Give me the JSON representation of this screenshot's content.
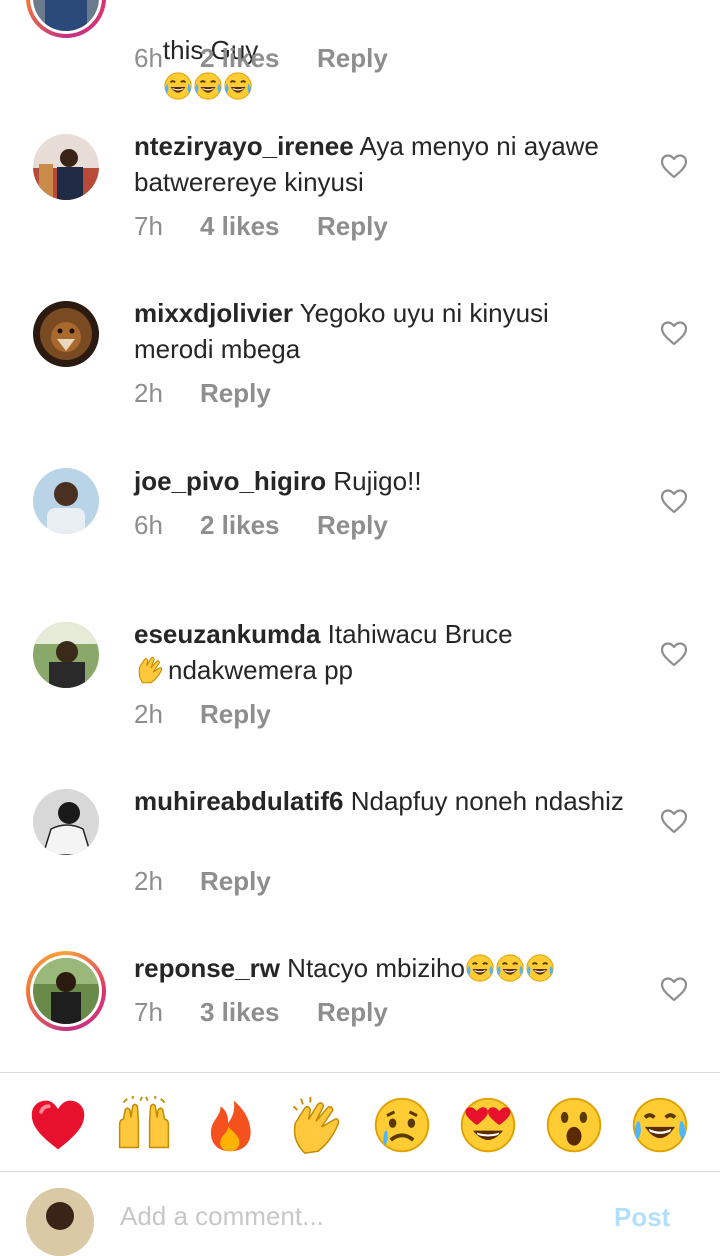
{
  "comments": [
    {
      "username": "",
      "text": "this Guy",
      "emoji_count": 3,
      "time": "6h",
      "likes": "2 likes",
      "reply": "Reply"
    },
    {
      "username": "nteziryayo_irenee",
      "text": " Aya menyo ni ayawe batwerereye kinyusi",
      "time": "7h",
      "likes": "4 likes",
      "reply": "Reply"
    },
    {
      "username": "mixxdjolivier",
      "text": " Yegoko uyu ni kinyusi merodi mbega",
      "time": "2h",
      "likes": "",
      "reply": "Reply"
    },
    {
      "username": "joe_pivo_higiro",
      "text": " Rujigo!!",
      "time": "6h",
      "likes": "2 likes",
      "reply": "Reply"
    },
    {
      "username": "eseuzankumda",
      "text": " Itahiwacu Bruce",
      "text2": "ndakwemera pp",
      "time": "2h",
      "likes": "",
      "reply": "Reply"
    },
    {
      "username": "muhireabdulatif6",
      "text": " Ndapfuy noneh ndashiz",
      "time": "2h",
      "likes": "",
      "reply": "Reply"
    },
    {
      "username": "reponse_rw",
      "text": " Ntacyo mbiziho",
      "emoji_count": 3,
      "time": "7h",
      "likes": "3 likes",
      "reply": "Reply"
    }
  ],
  "reactions": [
    "red-heart",
    "raising-hands",
    "fire",
    "clapping-hands",
    "sad-face",
    "heart-eyes",
    "surprised-face",
    "tears-of-joy"
  ],
  "composer": {
    "placeholder": "Add a comment...",
    "post_label": "Post"
  },
  "colors": {
    "text": "#262626",
    "muted": "#8e8e8e",
    "divider": "#dbdbdb",
    "post_disabled": "#b2dffc"
  }
}
